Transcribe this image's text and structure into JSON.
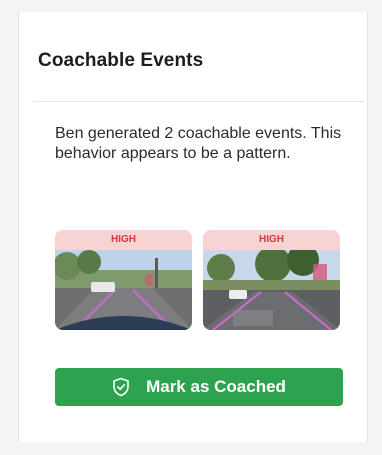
{
  "card": {
    "title": "Coachable Events",
    "description": "Ben generated 2 coachable events. This behavior appears to be a pattern."
  },
  "events": [
    {
      "severity": "HIGH"
    },
    {
      "severity": "HIGH"
    }
  ],
  "actions": {
    "mark_coached_label": "Mark as Coached",
    "mark_coached_icon": "shield-check-icon"
  },
  "colors": {
    "accent_green": "#2ea34f",
    "severity_bg": "#f8d3d3",
    "severity_text": "#d23a3a"
  }
}
